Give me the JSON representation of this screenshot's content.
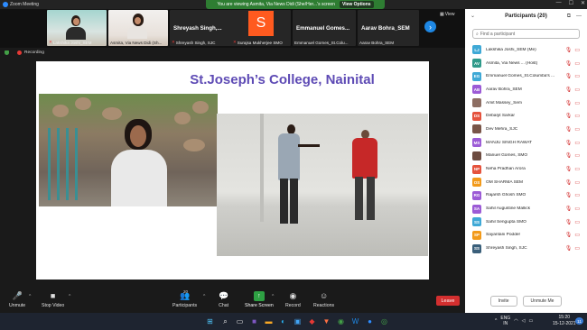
{
  "window": {
    "title": "Zoom Meeting"
  },
  "banner": {
    "text": "You are viewing Asmita, Via News Didi (She/Her...’s screen",
    "view_options": "View Options"
  },
  "strip": {
    "view_label": "View",
    "tiles": [
      {
        "name": "Lakshika Joshi_SEM"
      },
      {
        "name": "Asmita, Via News Didi (Sh..."
      },
      {
        "big": "Shreyash Singh,...",
        "name": "Shreyash Singh, SJC"
      },
      {
        "avatar": "S",
        "name": "Surajsa Mukherjee SMO"
      },
      {
        "big": "Emmanuel Gomes...",
        "name": "Emmanuel Gomes_St.Colu..."
      },
      {
        "big": "Aarav Bohra_SEM",
        "name": "Aarav Bohra_SEM"
      }
    ]
  },
  "recording": {
    "label": "Recording"
  },
  "slide": {
    "title": "St.Joseph’s College, Nainital"
  },
  "toolbar": {
    "unmute": "Unmute",
    "stop_video": "Stop Video",
    "participants": "Participants",
    "participants_count": "20",
    "chat": "Chat",
    "share_screen": "Share Screen",
    "record": "Record",
    "reactions": "Reactions",
    "leave": "Leave"
  },
  "panel": {
    "title": "Participants (20)",
    "search_placeholder": "Find a participant",
    "invite": "Invite",
    "unmute_me": "Unmute Me",
    "participants": [
      {
        "initials": "LJ",
        "color": "#3fa9d6",
        "name": "Lakshika Joshi_SEM (Me)"
      },
      {
        "initials": "AV",
        "color": "#2f9a8a",
        "name": "Asmita, Via News ... (Host)"
      },
      {
        "initials": "EG",
        "color": "#3fa9d6",
        "name": "Emmanuel Gomes_St.Columba's ..."
      },
      {
        "initials": "AB",
        "color": "#9c5bd6",
        "name": "Aarav Bohra_SEM"
      },
      {
        "initials": "",
        "color": "#8d6e63",
        "name": "Amit Massey_Sem"
      },
      {
        "initials": "DS",
        "color": "#e5533d",
        "name": "Debarjit Sarkar"
      },
      {
        "initials": "",
        "color": "#795548",
        "name": "Dev Mehra_SJC"
      },
      {
        "initials": "MS",
        "color": "#9c5bd6",
        "name": "MANJU SINGH RAWAT"
      },
      {
        "initials": "",
        "color": "#6d4c41",
        "name": "Manuel Gomes, SMO"
      },
      {
        "initials": "NP",
        "color": "#e5533d",
        "name": "Neha Pradhan Arora"
      },
      {
        "initials": "OS",
        "color": "#f29a1a",
        "name": "OM SHARMA SEM"
      },
      {
        "initials": "RG",
        "color": "#9c5bd6",
        "name": "Rajarsh Ghosh SMO"
      },
      {
        "initials": "SA",
        "color": "#9c5bd6",
        "name": "Sahil Augustine Mallick"
      },
      {
        "initials": "SS",
        "color": "#3fa9d6",
        "name": "Sahil Sengupta SMO"
      },
      {
        "initials": "SP",
        "color": "#f29a1a",
        "name": "Sayantani Podder"
      },
      {
        "initials": "SS",
        "color": "#3a5f7a",
        "name": "Shreyash Singh, SJC"
      }
    ]
  },
  "taskbar": {
    "lang_top": "ENG",
    "lang_bottom": "IN",
    "time": "15:20",
    "date": "15-12-2021",
    "notifications": "11"
  }
}
